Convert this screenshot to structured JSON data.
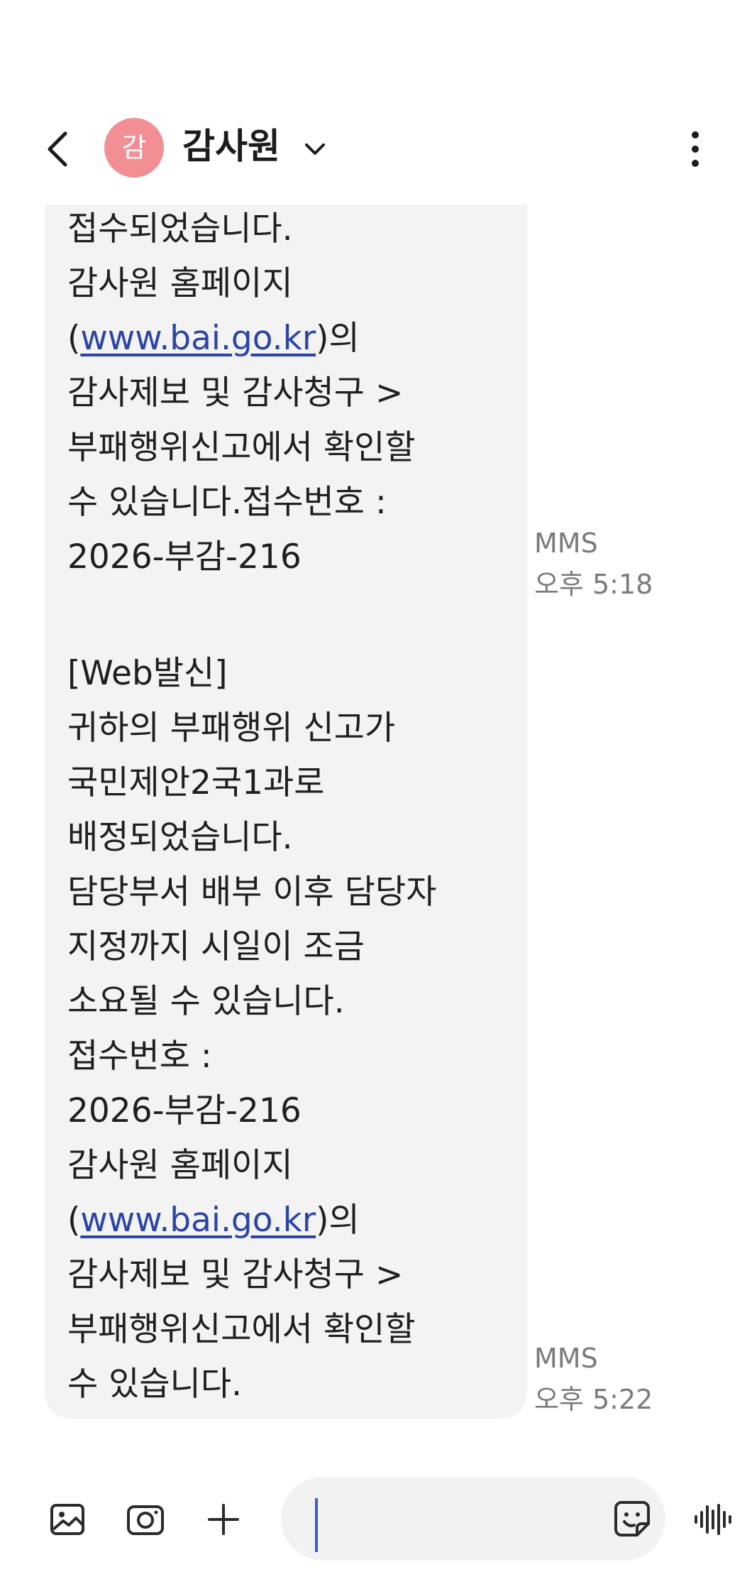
{
  "header": {
    "avatar_text": "감",
    "contact_name": "감사원",
    "colors": {
      "avatar": "#f28f95"
    }
  },
  "messages": [
    {
      "lines": [
        {
          "text": "접수되었습니다."
        },
        {
          "text": "감사원 홈페이지"
        },
        {
          "pre": "(",
          "link": "www.bai.go.kr",
          "post": ")의"
        },
        {
          "text": "감사제보 및 감사청구 >"
        },
        {
          "text": "부패행위신고에서 확인할"
        },
        {
          "text": "수 있습니다.접수번호 :"
        },
        {
          "text": "2026-부감-216"
        }
      ],
      "type_label": "MMS",
      "time": "오후 5:18"
    },
    {
      "lines": [
        {
          "text": "[Web발신]"
        },
        {
          "text": "귀하의 부패행위 신고가"
        },
        {
          "text": "국민제안2국1과로"
        },
        {
          "text": "배정되었습니다."
        },
        {
          "text": "담당부서 배부 이후 담당자"
        },
        {
          "text": "지정까지 시일이 조금"
        },
        {
          "text": "소요될 수 있습니다."
        },
        {
          "text": "접수번호 :"
        },
        {
          "text": "2026-부감-216"
        },
        {
          "text": "감사원 홈페이지"
        },
        {
          "pre": "(",
          "link": "www.bai.go.kr",
          "post": ")의"
        },
        {
          "text": "감사제보 및 감사청구 >"
        },
        {
          "text": "부패행위신고에서 확인할"
        },
        {
          "text": "수 있습니다."
        }
      ],
      "type_label": "MMS",
      "time": "오후 5:22"
    }
  ],
  "composer": {
    "input_value": "",
    "icons": [
      "gallery-icon",
      "camera-icon",
      "plus-icon",
      "sticker-icon",
      "voice-icon"
    ],
    "colors": {
      "caret": "#3a5bd9",
      "link": "#2a44a8"
    }
  }
}
